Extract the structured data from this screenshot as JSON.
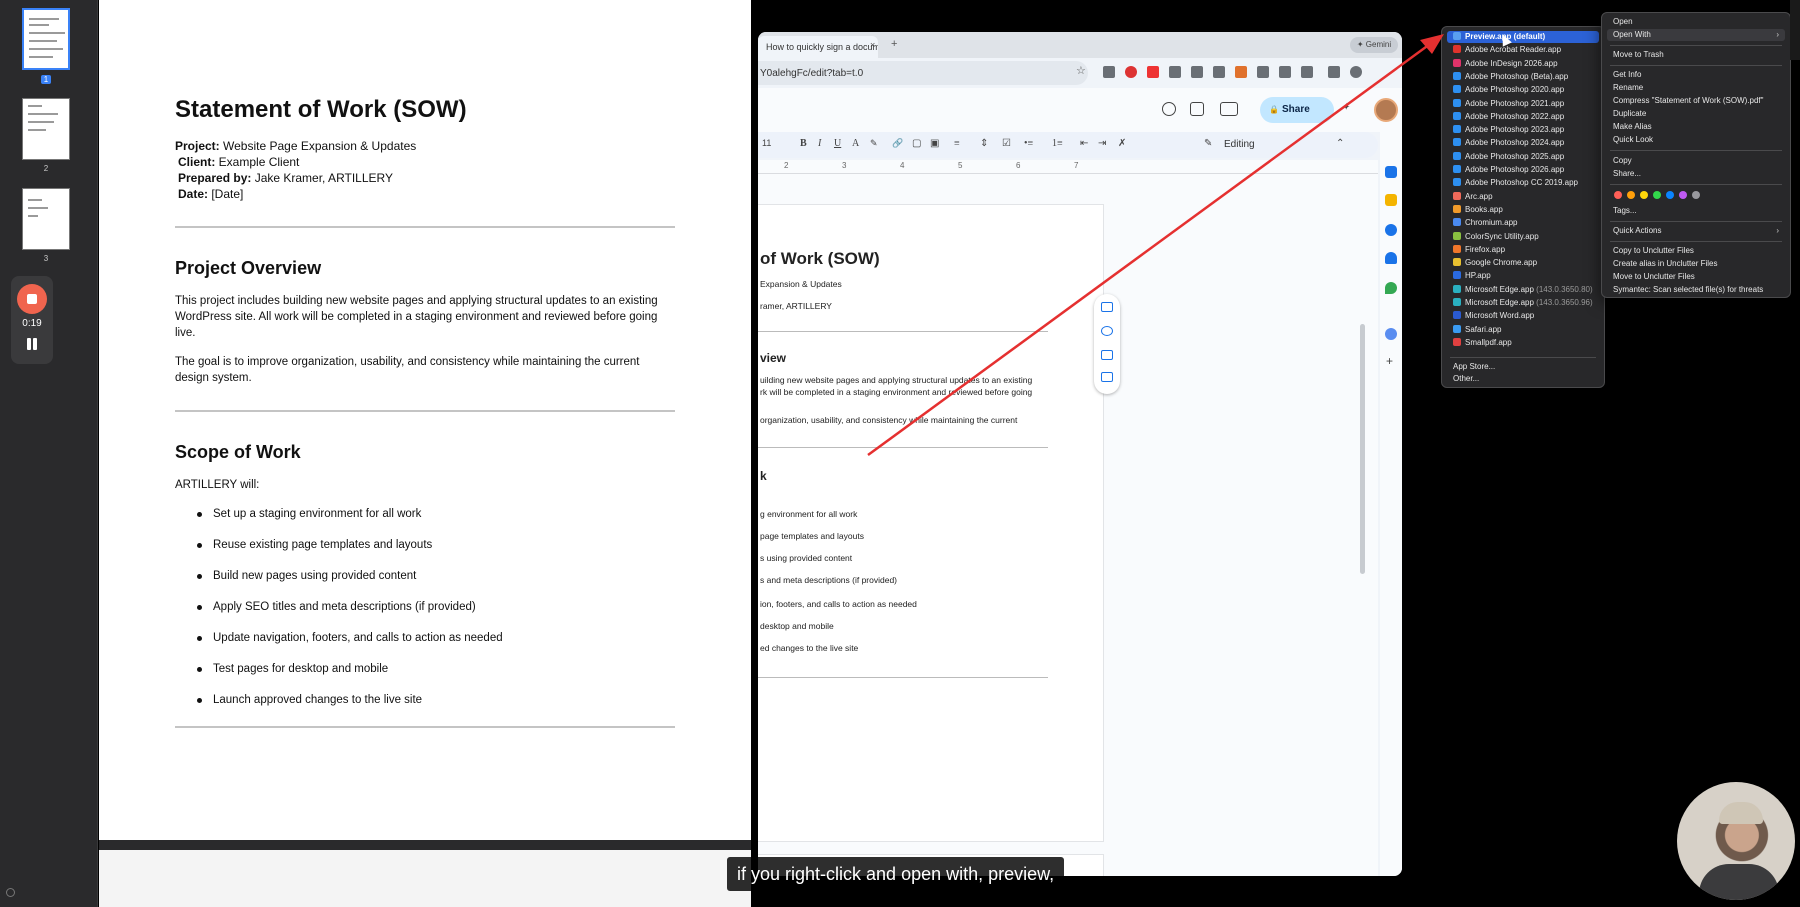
{
  "preview_sidebar": {
    "pages": [
      {
        "number": "1",
        "selected": true
      },
      {
        "number": "2",
        "selected": false
      },
      {
        "number": "3",
        "selected": false
      }
    ],
    "recorder": {
      "time": "0:19"
    }
  },
  "preview_doc": {
    "title": "Statement of Work (SOW)",
    "meta": [
      {
        "label": "Project:",
        "value": " Website Page Expansion & Updates"
      },
      {
        "label": "Client:",
        "value": " Example Client"
      },
      {
        "label": "Prepared by:",
        "value": " Jake Kramer, ARTILLERY"
      },
      {
        "label": "Date:",
        "value": " [Date]"
      }
    ],
    "overview_heading": "Project Overview",
    "overview_p1": "This project includes building new website pages and applying structural updates to an existing WordPress site. All work will be completed in a staging environment and reviewed before going live.",
    "overview_p2": "The goal is to improve organization, usability, and consistency while maintaining the current design system.",
    "scope_heading": "Scope of Work",
    "scope_intro": "ARTILLERY will:",
    "scope_items": [
      "Set up a staging environment for all work",
      "Reuse existing page templates and layouts",
      "Build new pages using provided content",
      "Apply SEO titles and meta descriptions (if provided)",
      "Update navigation, footers, and calls to action as needed",
      "Test pages for desktop and mobile",
      "Launch approved changes to the live site"
    ]
  },
  "chrome": {
    "tab_title": "How to quickly sign a docum",
    "tab_close": "×",
    "new_tab": "+",
    "gemini": "✦ Gemini",
    "url": "Y0alehgFc/edit?tab=t.0",
    "share_label": "Share",
    "editing_label": "Editing",
    "ruler_ticks": [
      "2",
      "3",
      "4",
      "5",
      "6",
      "7"
    ],
    "toolbar_items": [
      "11",
      "B",
      "I",
      "U",
      "A"
    ],
    "gdoc_lines": [
      {
        "text": "of Work (SOW)",
        "heading": true
      },
      {
        "text": " Expansion & Updates",
        "heading": false
      },
      {
        "text": "ramer, ARTILLERY",
        "heading": false
      },
      {
        "text": "view",
        "heading": true
      },
      {
        "text": "uilding new website pages and applying structural updates to an existing",
        "heading": false
      },
      {
        "text": "rk will be completed in a staging environment and reviewed before going",
        "heading": false
      },
      {
        "text": "organization, usability, and consistency while maintaining the current",
        "heading": false
      },
      {
        "text": "k",
        "heading": true
      },
      {
        "text": "g environment for all work",
        "heading": false
      },
      {
        "text": "page templates and layouts",
        "heading": false
      },
      {
        "text": "s using provided content",
        "heading": false
      },
      {
        "text": "s and meta descriptions (if provided)",
        "heading": false
      },
      {
        "text": "ion, footers, and calls to action as needed",
        "heading": false
      },
      {
        "text": "desktop and mobile",
        "heading": false
      },
      {
        "text": "ed changes to the live site",
        "heading": false
      }
    ]
  },
  "open_with_menu": {
    "items": [
      {
        "label": "Preview.app (default)",
        "version": "",
        "highlighted": true,
        "color": "#5aa0f0"
      },
      {
        "label": "Adobe Acrobat Reader.app",
        "version": "",
        "highlighted": false,
        "color": "#e0332c"
      },
      {
        "label": "Adobe InDesign 2026.app",
        "version": "",
        "highlighted": false,
        "color": "#e0336a"
      },
      {
        "label": "Adobe Photoshop (Beta).app",
        "version": "",
        "highlighted": false,
        "color": "#2d8ff0"
      },
      {
        "label": "Adobe Photoshop 2020.app",
        "version": "",
        "highlighted": false,
        "color": "#2d8ff0"
      },
      {
        "label": "Adobe Photoshop 2021.app",
        "version": "",
        "highlighted": false,
        "color": "#2d8ff0"
      },
      {
        "label": "Adobe Photoshop 2022.app",
        "version": "",
        "highlighted": false,
        "color": "#2d8ff0"
      },
      {
        "label": "Adobe Photoshop 2023.app",
        "version": "",
        "highlighted": false,
        "color": "#2d8ff0"
      },
      {
        "label": "Adobe Photoshop 2024.app",
        "version": "",
        "highlighted": false,
        "color": "#2d8ff0"
      },
      {
        "label": "Adobe Photoshop 2025.app",
        "version": "",
        "highlighted": false,
        "color": "#2d8ff0"
      },
      {
        "label": "Adobe Photoshop 2026.app",
        "version": "",
        "highlighted": false,
        "color": "#2d8ff0"
      },
      {
        "label": "Adobe Photoshop CC 2019.app",
        "version": "",
        "highlighted": false,
        "color": "#2d8ff0"
      },
      {
        "label": "Arc.app",
        "version": "",
        "highlighted": false,
        "color": "#f06a5a"
      },
      {
        "label": "Books.app",
        "version": "",
        "highlighted": false,
        "color": "#f09a2a"
      },
      {
        "label": "Chromium.app",
        "version": "",
        "highlighted": false,
        "color": "#4a8af0"
      },
      {
        "label": "ColorSync Utility.app",
        "version": "",
        "highlighted": false,
        "color": "#8ac040"
      },
      {
        "label": "Firefox.app",
        "version": "",
        "highlighted": false,
        "color": "#f0762a"
      },
      {
        "label": "Google Chrome.app",
        "version": "",
        "highlighted": false,
        "color": "#e8c030"
      },
      {
        "label": "HP.app",
        "version": "",
        "highlighted": false,
        "color": "#2a6ae0"
      },
      {
        "label": "Microsoft Edge.app",
        "version": " (143.0.3650.80)",
        "highlighted": false,
        "color": "#2ab0c0"
      },
      {
        "label": "Microsoft Edge.app",
        "version": " (143.0.3650.96)",
        "highlighted": false,
        "color": "#2ab0c0"
      },
      {
        "label": "Microsoft Word.app",
        "version": "",
        "highlighted": false,
        "color": "#2a5ad0"
      },
      {
        "label": "Safari.app",
        "version": "",
        "highlighted": false,
        "color": "#3a9af0"
      },
      {
        "label": "Smallpdf.app",
        "version": "",
        "highlighted": false,
        "color": "#e04040"
      }
    ],
    "footer": [
      "App Store...",
      "Other..."
    ]
  },
  "context_menu": {
    "group1": [
      "Open",
      "Open With"
    ],
    "group2": [
      "Move to Trash"
    ],
    "group3": [
      "Get Info",
      "Rename",
      "Compress \"Statement of Work (SOW).pdf\"",
      "Duplicate",
      "Make Alias",
      "Quick Look"
    ],
    "group4": [
      "Copy",
      "Share..."
    ],
    "tag_colors": [
      "#ff5f57",
      "#ff9f0a",
      "#ffd60a",
      "#32d74b",
      "#0a84ff",
      "#bf5af2",
      "#98989d"
    ],
    "tags_label": "Tags...",
    "quick_actions": "Quick Actions",
    "group6": [
      "Copy to Unclutter Files",
      "Create alias in Unclutter Files",
      "Move to Unclutter Files",
      "Symantec: Scan selected file(s) for threats"
    ]
  },
  "caption": "if you right-click and open with, preview,",
  "colors": {
    "annotation_arrow": "#e53030",
    "menu_highlight": "#2c62d6",
    "share_button": "#c2e7ff"
  }
}
